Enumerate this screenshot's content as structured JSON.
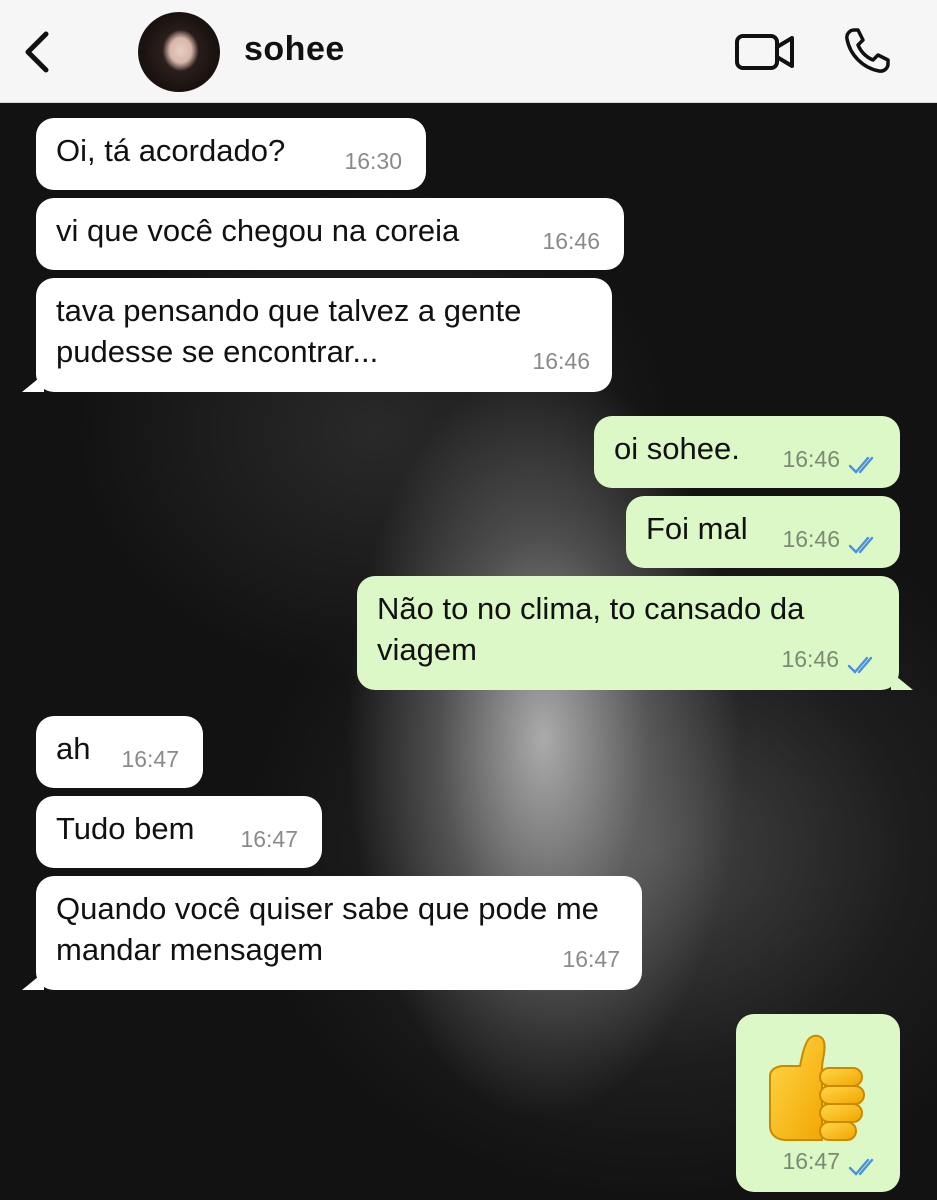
{
  "header": {
    "contact_name": "sohee",
    "back_icon": "chevron-left-icon",
    "video_icon": "video-camera-icon",
    "phone_icon": "phone-icon"
  },
  "colors": {
    "incoming_bubble": "#ffffff",
    "outgoing_bubble": "#dcf8c6",
    "read_ticks": "#4a90e2"
  },
  "messages": [
    {
      "direction": "incoming",
      "text": "Oi, tá acordado?",
      "time": "16:30"
    },
    {
      "direction": "incoming",
      "text": "vi que você chegou na coreia",
      "time": "16:46"
    },
    {
      "direction": "incoming",
      "text": "tava pensando que talvez a gente pudesse se encontrar...",
      "time": "16:46"
    },
    {
      "direction": "outgoing",
      "text": "oi sohee.",
      "time": "16:46",
      "status": "read"
    },
    {
      "direction": "outgoing",
      "text": "Foi mal",
      "time": "16:46",
      "status": "read"
    },
    {
      "direction": "outgoing",
      "text": "Não to no clima, to cansado da viagem",
      "time": "16:46",
      "status": "read"
    },
    {
      "direction": "incoming",
      "text": "ah",
      "time": "16:47"
    },
    {
      "direction": "incoming",
      "text": "Tudo bem",
      "time": "16:47"
    },
    {
      "direction": "incoming",
      "text": "Quando você quiser sabe que pode me mandar mensagem",
      "time": "16:47"
    },
    {
      "direction": "outgoing",
      "emoji": "thumbs-up",
      "time": "16:47",
      "status": "read"
    }
  ]
}
